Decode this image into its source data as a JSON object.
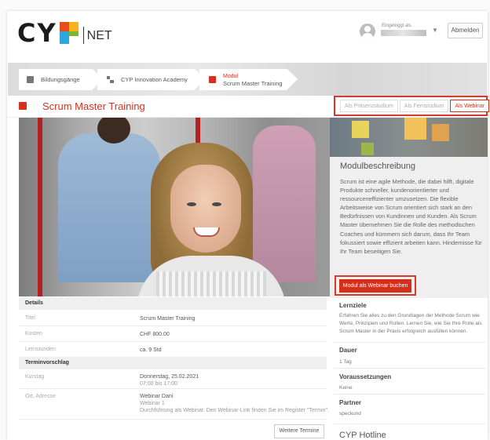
{
  "header": {
    "logo_letters": "CY",
    "logo_suffix": "NET",
    "user_label": "Eingeloggt als",
    "logout_label": "Abmelden"
  },
  "breadcrumb": [
    {
      "label": "Bildungsgänge"
    },
    {
      "label": "CYP Innovation Academy"
    },
    {
      "prefix": "Modul",
      "label": "Scrum Master Training"
    }
  ],
  "page": {
    "title": "Scrum Master Training",
    "modes": [
      "Als Präsenzstudium",
      "Als Fernstudium",
      "Als Webinar"
    ]
  },
  "description": {
    "title": "Modulbeschreibung",
    "text": "Scrum ist eine agile Methode, die dabei hilft, digitale Produkte schneller, kundenorientierter und ressourceneffizienter umzusetzen. Die flexible Arbeitsweise von Scrum orientiert sich stark an den Bedürfnissen von Kundinnen und Kunden. Als Scrum Master übernehmen Sie die Rolle des methodischen Coaches und kümmern sich darum, dass Ihr Team fokussiert sowie effizient arbeiten kann. Hindernisse für Ihr Team beseitigen Sie.",
    "book_label": "Modul als Webinar buchen"
  },
  "info": {
    "lernziele_title": "Lernziele",
    "lernziele_text": "Erfahren Sie alles zu den Grundlagen der Methode Scrum wie Werte, Prinzipien und Rollen. Lernen Sie, wie Sie Ihre Rolle als Scrum Master in der Praxis erfolgreich ausfüllen können.",
    "dauer_title": "Dauer",
    "dauer_value": "1 Tag",
    "voraus_title": "Voraussetzungen",
    "voraus_value": "Keine",
    "partner_title": "Partner",
    "partner_value": "speckund",
    "hotline_title": "CYP Hotline"
  },
  "details": {
    "section_title": "Details",
    "rows": [
      {
        "label": "Titel",
        "value": "Scrum Master Training"
      },
      {
        "label": "Kosten",
        "value": "CHF 800.00"
      },
      {
        "label": "Lernstunden",
        "value": "ca. 9 Std"
      }
    ],
    "termin_title": "Terminvorschlag",
    "kurstag_label": "Kurstag",
    "kurstag_value": "Donnerstag, 25.02.2021",
    "kurstag_time": "07:00 bis 17:00",
    "ort_label": "Ort, Adresse",
    "ort_value": "Webinar Dani",
    "ort_sub": "Webinar 1",
    "ort_note": "Durchführung als Webinar. Den Webinar-Link finden Sie im Register \"Termin\".",
    "more_label": "Weitere Termine"
  }
}
